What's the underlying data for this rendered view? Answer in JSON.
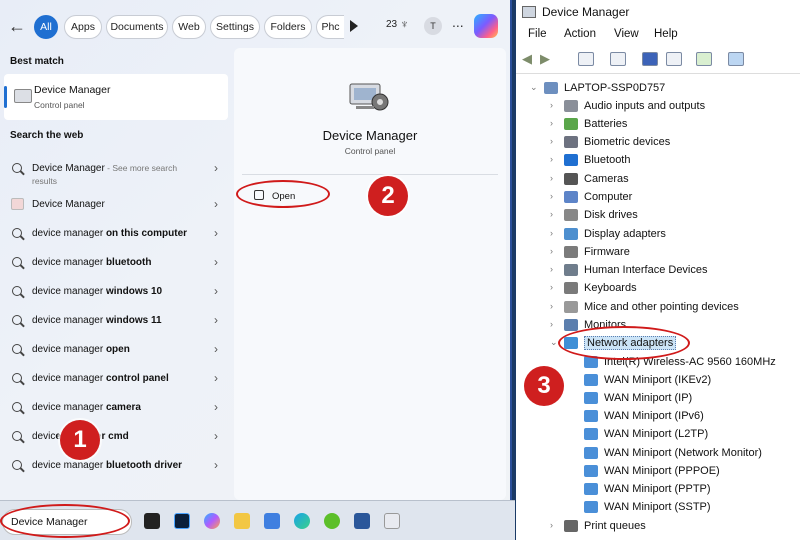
{
  "search": {
    "filters": [
      {
        "label": "All",
        "active": true
      },
      {
        "label": "Apps",
        "active": false
      },
      {
        "label": "Documents",
        "active": false
      },
      {
        "label": "Web",
        "active": false
      },
      {
        "label": "Settings",
        "active": false
      },
      {
        "label": "Folders",
        "active": false
      },
      {
        "label": "Phc",
        "active": false
      }
    ],
    "points": "23",
    "avatar": "T",
    "more": "...",
    "best_match_title": "Best match",
    "best_match": {
      "title": "Device Manager",
      "subtitle": "Control panel"
    },
    "web_title": "Search the web",
    "web_results": [
      {
        "prefix": "Device Manager",
        "bold": "",
        "hint": " - See more search",
        "hint2": "results",
        "icon": "search-icon"
      },
      {
        "prefix": "Device Manager",
        "bold": "",
        "hint": "",
        "hint2": "",
        "icon": "device-manager-icon"
      },
      {
        "prefix": "device manager ",
        "bold": "on this computer",
        "hint": "",
        "hint2": "",
        "icon": "search-icon"
      },
      {
        "prefix": "device manager ",
        "bold": "bluetooth",
        "hint": "",
        "hint2": "",
        "icon": "search-icon"
      },
      {
        "prefix": "device manager ",
        "bold": "windows 10",
        "hint": "",
        "hint2": "",
        "icon": "search-icon"
      },
      {
        "prefix": "device manager ",
        "bold": "windows 11",
        "hint": "",
        "hint2": "",
        "icon": "search-icon"
      },
      {
        "prefix": "device manager ",
        "bold": "open",
        "hint": "",
        "hint2": "",
        "icon": "search-icon"
      },
      {
        "prefix": "device manager ",
        "bold": "control panel",
        "hint": "",
        "hint2": "",
        "icon": "search-icon"
      },
      {
        "prefix": "device manager ",
        "bold": "camera",
        "hint": "",
        "hint2": "",
        "icon": "search-icon"
      },
      {
        "prefix": "devic",
        "bold": "e manager cmd",
        "hint": "",
        "hint2": "",
        "icon": "search-icon"
      },
      {
        "prefix": "device manager ",
        "bold": "bluetooth driver",
        "hint": "",
        "hint2": "",
        "icon": "search-icon"
      }
    ],
    "preview": {
      "title": "Device Manager",
      "subtitle": "Control panel",
      "open_label": "Open"
    },
    "query": "Device Manager"
  },
  "badges": [
    "1",
    "2",
    "3"
  ],
  "device_manager": {
    "window_title": "Device Manager",
    "menu": [
      "File",
      "Action",
      "View",
      "Help"
    ],
    "root": "LAPTOP-SSP0D757",
    "categories": [
      "Audio inputs and outputs",
      "Batteries",
      "Biometric devices",
      "Bluetooth",
      "Cameras",
      "Computer",
      "Disk drives",
      "Display adapters",
      "Firmware",
      "Human Interface Devices",
      "Keyboards",
      "Mice and other pointing devices",
      "Monitors",
      "Network adapters"
    ],
    "network_adapters": [
      "Intel(R) Wireless-AC 9560 160MHz",
      "WAN Miniport (IKEv2)",
      "WAN Miniport (IP)",
      "WAN Miniport (IPv6)",
      "WAN Miniport (L2TP)",
      "WAN Miniport (Network Monitor)",
      "WAN Miniport (PPPOE)",
      "WAN Miniport (PPTP)",
      "WAN Miniport (SSTP)"
    ],
    "after": [
      "Print queues"
    ]
  }
}
